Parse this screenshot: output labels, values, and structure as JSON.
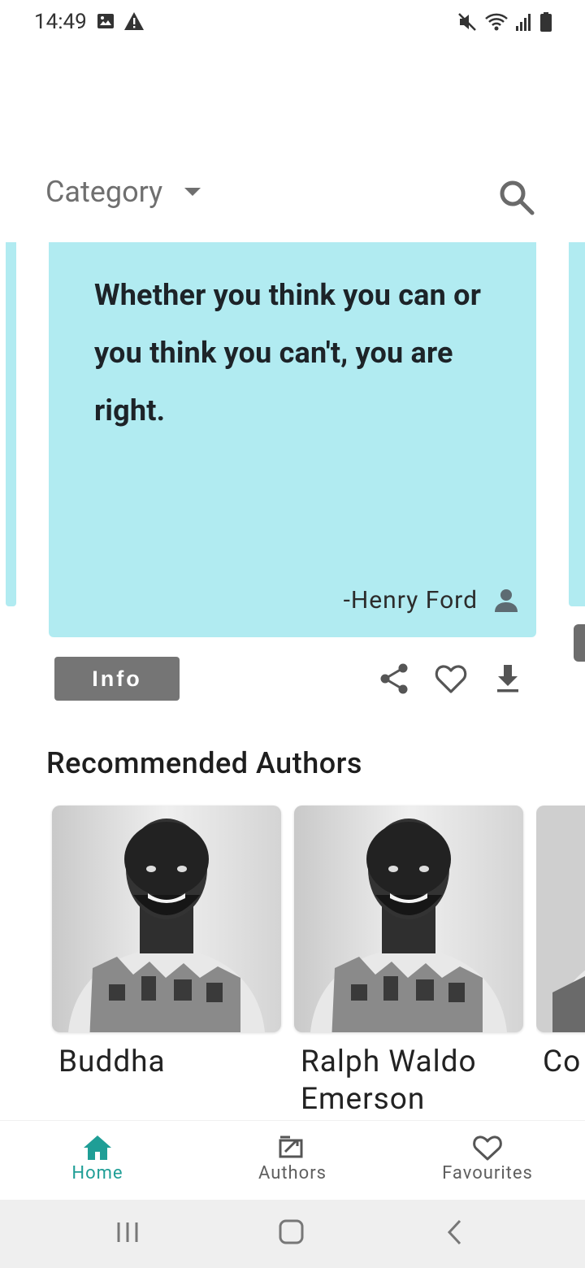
{
  "status_bar": {
    "time": "14:49",
    "left_icons": [
      "image-icon",
      "warning-icon"
    ],
    "right_icons": [
      "mute-icon",
      "wifi-icon",
      "signal-icon",
      "battery-icon"
    ]
  },
  "toolbar": {
    "category_label": "Category",
    "category_icon": "dropdown-arrow-icon",
    "search_icon": "search-icon"
  },
  "quote_card": {
    "text": "Whether you think you can or you think you can't, you are right.",
    "author": "-Henry Ford",
    "background": "#b1ebf1"
  },
  "actions": {
    "info_label": "Info",
    "icons": [
      "share-icon",
      "heart-icon",
      "download-icon"
    ]
  },
  "recommended": {
    "title": "Recommended Authors",
    "authors": [
      {
        "name": "Buddha"
      },
      {
        "name": "Ralph Waldo Emerson"
      },
      {
        "name": "Co"
      }
    ]
  },
  "bottom_nav": {
    "items": [
      {
        "label": "Home",
        "icon": "home-icon",
        "active": true
      },
      {
        "label": "Authors",
        "icon": "authors-icon",
        "active": false
      },
      {
        "label": "Favourites",
        "icon": "heart-icon",
        "active": false
      }
    ],
    "active_color": "#1f9e96"
  }
}
